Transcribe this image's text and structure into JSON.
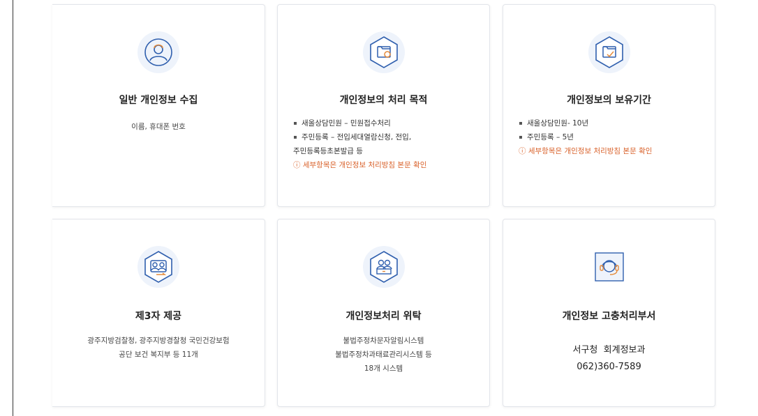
{
  "colors": {
    "accent": "#2f5fae",
    "note": "#d9622b",
    "icon_bg": "#eef3fb"
  },
  "cards": [
    {
      "icon": "person-icon",
      "title": "일반 개인정보 수집",
      "desc_lines": [
        "이름, 휴대폰 번호"
      ]
    },
    {
      "icon": "document-folder-icon",
      "title": "개인정보의 처리 목적",
      "items": [
        "새올상담민원 – 민원접수처리",
        "주민등록 – 전입세대열람신청, 전입,"
      ],
      "item_continuation": "주민등록등초본발급 등",
      "note": "ⓘ 세부항목은 개인정보 처리방침 본문 확인"
    },
    {
      "icon": "folder-clock-icon",
      "title": "개인정보의 보유기간",
      "items": [
        "새올상담민원- 10년",
        "주민등록 – 5년"
      ],
      "note": "ⓘ 세부항목은 개인정보 처리방침 본문 확인"
    },
    {
      "icon": "people-share-icon",
      "title": "제3자 제공",
      "desc_lines": [
        "광주지방검찰청, 광주지방경찰청 국민건강보험",
        "공단 보건 복지부 등 11개"
      ]
    },
    {
      "icon": "people-monitor-icon",
      "title": "개인정보처리 위탁",
      "desc_lines": [
        "불법주정차문자알림시스템",
        "불법주정차과태료관리시스템 등",
        "18개 시스템"
      ]
    },
    {
      "icon": "headset-icon",
      "title": "개인정보 고충처리부서",
      "contact_lines": [
        "서구청  회계정보과",
        "062)360-7589"
      ]
    }
  ]
}
